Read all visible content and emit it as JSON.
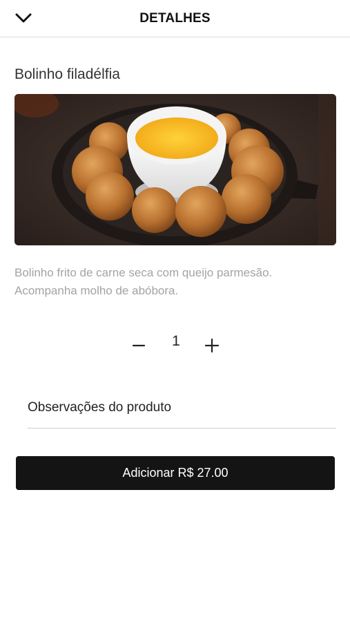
{
  "header": {
    "title": "DETALHES",
    "back_icon": "chevron-down-icon"
  },
  "product": {
    "name": "Bolinho filadélfia",
    "image_alt": "Bolinho filadélfia",
    "description": "Bolinho frito de carne seca com queijo parmesão. Acompanha molho de abóbora."
  },
  "quantity": {
    "minus": "−",
    "value": "1",
    "plus": "+"
  },
  "observations": {
    "label": "Observações do produto"
  },
  "add_button": {
    "label": "Adicionar R$ 27.00"
  },
  "colors": {
    "button_bg": "#141414",
    "description": "#a3a3a3",
    "divider": "#dcdcdc"
  }
}
